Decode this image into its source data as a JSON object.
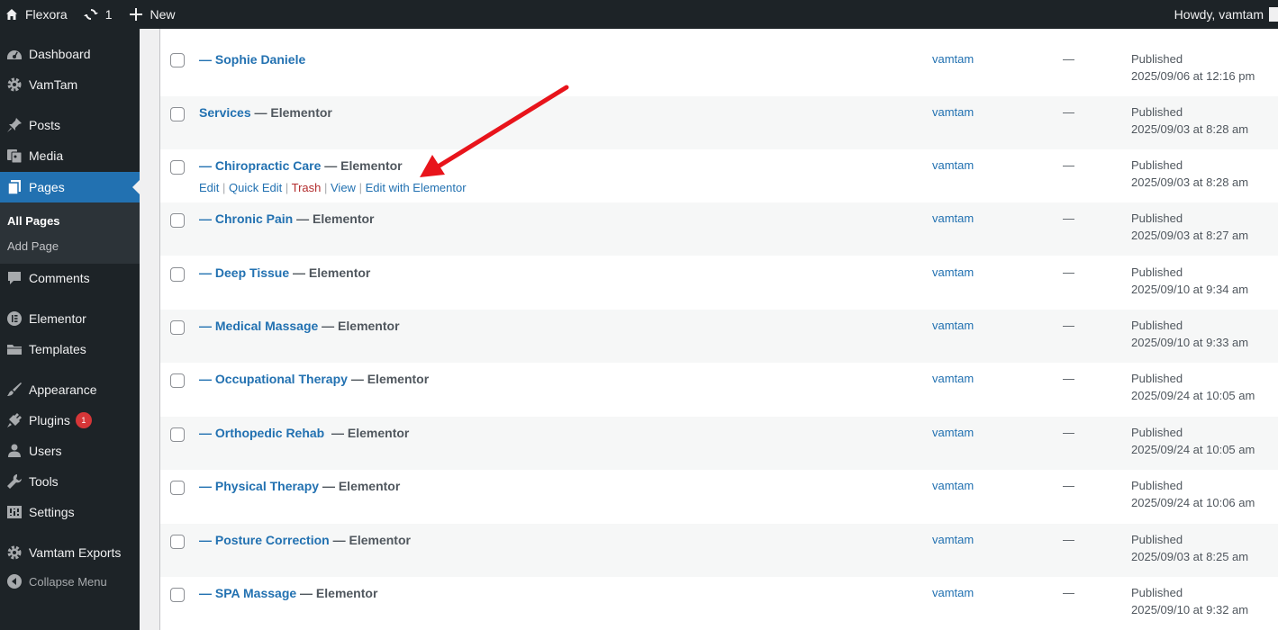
{
  "admin_bar": {
    "site_name": "Flexora",
    "updates_count": "1",
    "new_label": "New",
    "howdy": "Howdy, vamtam",
    "icons": [
      "home-icon",
      "updates-icon",
      "plus-icon"
    ]
  },
  "menu": {
    "items": [
      {
        "label": "Dashboard",
        "icon": "dashboard-icon"
      },
      {
        "label": "VamTam",
        "icon": "gear-icon"
      },
      {
        "label": "Posts",
        "icon": "pin-icon"
      },
      {
        "label": "Media",
        "icon": "media-icon"
      },
      {
        "label": "Pages",
        "icon": "pages-icon"
      },
      {
        "label": "Comments",
        "icon": "comment-icon"
      },
      {
        "label": "Elementor",
        "icon": "elementor-icon"
      },
      {
        "label": "Templates",
        "icon": "folder-icon"
      },
      {
        "label": "Appearance",
        "icon": "brush-icon"
      },
      {
        "label": "Plugins",
        "icon": "plug-icon",
        "badge": "1"
      },
      {
        "label": "Users",
        "icon": "user-icon"
      },
      {
        "label": "Tools",
        "icon": "wrench-icon"
      },
      {
        "label": "Settings",
        "icon": "settings-icon"
      },
      {
        "label": "Vamtam Exports",
        "icon": "gear-icon"
      },
      {
        "label": "Collapse Menu",
        "icon": "collapse-icon"
      }
    ],
    "submenu": [
      "All Pages",
      "Add Page"
    ]
  },
  "table": {
    "row_actions": [
      "Edit",
      "Quick Edit",
      "Trash",
      "View",
      "Edit with Elementor"
    ],
    "separator": " | ",
    "truncated_date_fragment": "…",
    "rows": [
      {
        "title": "— Sophie Daniele",
        "state": "",
        "author": "vamtam",
        "comments": "—",
        "status": "Published",
        "date": "2025/09/06 at 12:16 pm"
      },
      {
        "title": "Services",
        "state": " — Elementor",
        "author": "vamtam",
        "comments": "—",
        "status": "Published",
        "date": "2025/09/03 at 8:28 am"
      },
      {
        "title": "— Chiropractic Care",
        "state": " — Elementor",
        "author": "vamtam",
        "comments": "—",
        "status": "Published",
        "date": "2025/09/03 at 8:28 am"
      },
      {
        "title": "— Chronic Pain",
        "state": " — Elementor",
        "author": "vamtam",
        "comments": "—",
        "status": "Published",
        "date": "2025/09/03 at 8:27 am"
      },
      {
        "title": "— Deep Tissue",
        "state": " — Elementor",
        "author": "vamtam",
        "comments": "—",
        "status": "Published",
        "date": "2025/09/10 at 9:34 am"
      },
      {
        "title": "— Medical Massage",
        "state": " — Elementor",
        "author": "vamtam",
        "comments": "—",
        "status": "Published",
        "date": "2025/09/10 at 9:33 am"
      },
      {
        "title": "— Occupational Therapy",
        "state": " — Elementor",
        "author": "vamtam",
        "comments": "—",
        "status": "Published",
        "date": "2025/09/24 at 10:05 am"
      },
      {
        "title": "— Orthopedic Rehab ",
        "state": " — Elementor",
        "author": "vamtam",
        "comments": "—",
        "status": "Published",
        "date": "2025/09/24 at 10:05 am"
      },
      {
        "title": "— Physical Therapy",
        "state": " — Elementor",
        "author": "vamtam",
        "comments": "—",
        "status": "Published",
        "date": "2025/09/24 at 10:06 am"
      },
      {
        "title": "— Posture Correction",
        "state": " — Elementor",
        "author": "vamtam",
        "comments": "—",
        "status": "Published",
        "date": "2025/09/03 at 8:25 am"
      },
      {
        "title": "— SPA Massage",
        "state": " — Elementor",
        "author": "vamtam",
        "comments": "—",
        "status": "Published",
        "date": "2025/09/10 at 9:32 am"
      }
    ]
  },
  "colors": {
    "admin_bg": "#1d2327",
    "accent": "#2271b1",
    "trash": "#b32d2e",
    "badge": "#d63638",
    "arrow": "#e8141b"
  }
}
